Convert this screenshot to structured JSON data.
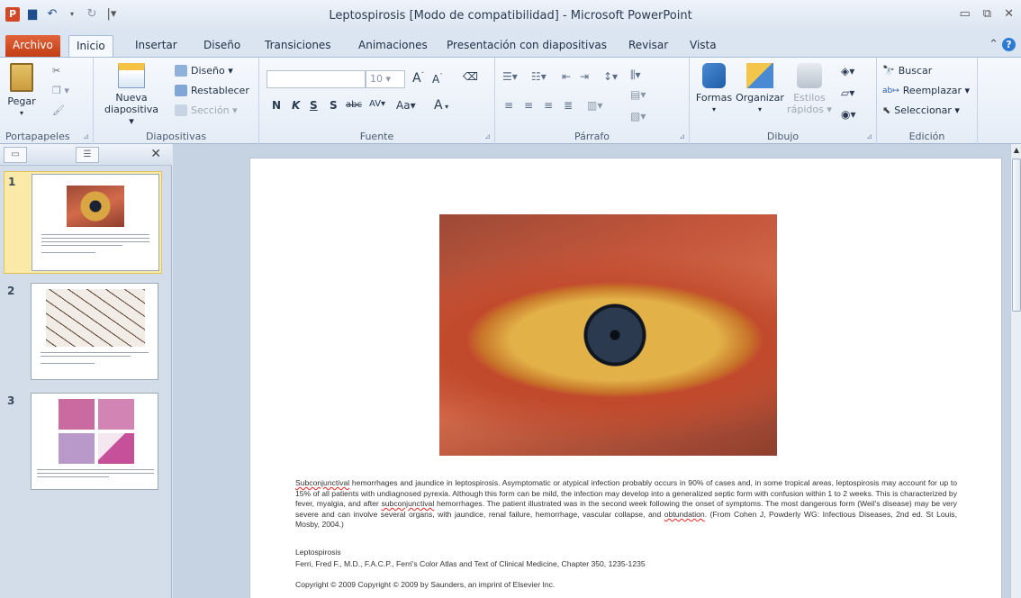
{
  "window": {
    "title": "Leptospirosis [Modo de compatibilidad] - Microsoft PowerPoint",
    "app_icon": "P"
  },
  "tabs": [
    "Archivo",
    "Inicio",
    "Insertar",
    "Diseño",
    "Transiciones",
    "Animaciones",
    "Presentación con diapositivas",
    "Revisar",
    "Vista"
  ],
  "ribbon": {
    "portapapeles": {
      "label": "Portapapeles",
      "pegar": "Pegar"
    },
    "diapositivas": {
      "label": "Diapositivas",
      "nueva_line1": "Nueva",
      "nueva_line2": "diapositiva ▾",
      "diseno": "Diseño ▾",
      "restablecer": "Restablecer",
      "seccion": "Sección ▾"
    },
    "fuente": {
      "label": "Fuente",
      "size": "10",
      "bold": "N",
      "italic": "K",
      "underline": "S",
      "shadow": "S",
      "strike": "abc",
      "spacing": "AV",
      "case": "Aa",
      "color": "A"
    },
    "parrafo": {
      "label": "Párrafo"
    },
    "dibujo": {
      "label": "Dibujo",
      "formas": "Formas",
      "organizar": "Organizar",
      "estilos_line1": "Estilos",
      "estilos_line2": "rápidos ▾"
    },
    "edicion": {
      "label": "Edición",
      "buscar": "Buscar",
      "reemplazar": "Reemplazar ▾",
      "seleccionar": "Seleccionar ▾"
    }
  },
  "slides_pane": {
    "numbers": [
      "1",
      "2",
      "3"
    ]
  },
  "slide": {
    "caption_parts": [
      "Subconjunctival",
      " hemorrhages and jaundice in leptospirosis. Asymptomatic or atypical infection probably occurs in 90% of cases and, in some tropical areas, leptospirosis may account for up to 15% of all patients with undiagnosed pyrexia. Although this form can be mild, the infection may develop into a generalized septic form with confusion within 1 to 2 weeks. This is characterized by fever, myalgia, and after ",
      "subconjunctival",
      " hemorrhages. The patient illustrated was in the second week following the onset of symptoms. The most dangerous form (Weil's disease) may be very severe and can involve several organs, with jaundice, renal failure, hemorrhage, vascular collapse, and ",
      "obtundation",
      ". (From Cohen J, Powderly WG: Infectious Diseases, 2nd ed. St Louis, Mosby, 2004.)"
    ],
    "ref_title": "Leptospirosis",
    "ref_line": "Ferri, Fred F., M.D., F.A.C.P., Ferri's Color Atlas and Text of Clinical Medicine, Chapter 350, 1235-1235",
    "copyright": "Copyright © 2009 Copyright © 2009 by Saunders, an imprint of Elsevier Inc."
  }
}
